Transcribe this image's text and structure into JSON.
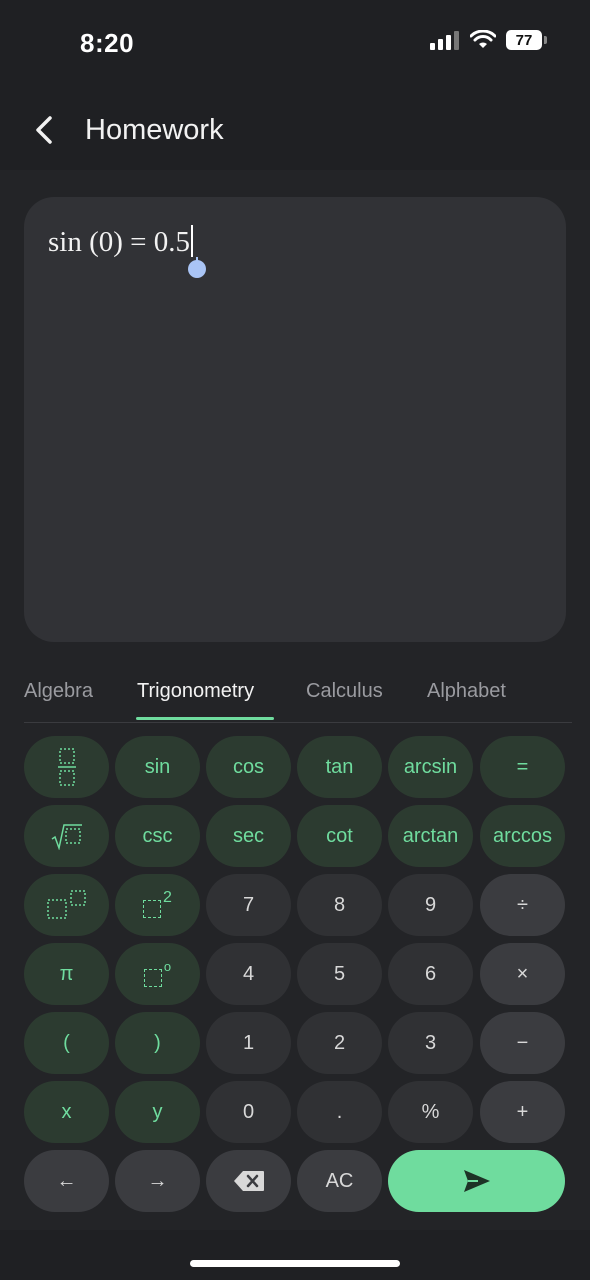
{
  "status": {
    "time": "8:20",
    "battery": "77"
  },
  "appbar": {
    "title": "Homework"
  },
  "editor": {
    "equation": "sin (0) = 0.5"
  },
  "tabs": [
    {
      "label": "Algebra",
      "active": false
    },
    {
      "label": "Trigonometry",
      "active": true
    },
    {
      "label": "Calculus",
      "active": false
    },
    {
      "label": "Alphabet",
      "active": false
    }
  ],
  "keys": {
    "sin": "sin",
    "cos": "cos",
    "tan": "tan",
    "arcsin": "arcsin",
    "equals": "=",
    "csc": "csc",
    "sec": "sec",
    "cot": "cot",
    "arctan": "arctan",
    "arccos": "arccos",
    "seven": "7",
    "eight": "8",
    "nine": "9",
    "divide": "÷",
    "pi": "π",
    "four": "4",
    "five": "5",
    "six": "6",
    "multiply": "×",
    "lparen": "(",
    "rparen": ")",
    "one": "1",
    "two": "2",
    "three": "3",
    "minus": "−",
    "x": "x",
    "y": "y",
    "zero": "0",
    "dot": ".",
    "percent": "%",
    "plus": "+",
    "left": "←",
    "right": "→",
    "ac": "AC",
    "square_exp": "2",
    "degree": "o"
  },
  "colors": {
    "accent": "#6fdc9e",
    "background": "#1f2023",
    "editor": "#313236"
  }
}
